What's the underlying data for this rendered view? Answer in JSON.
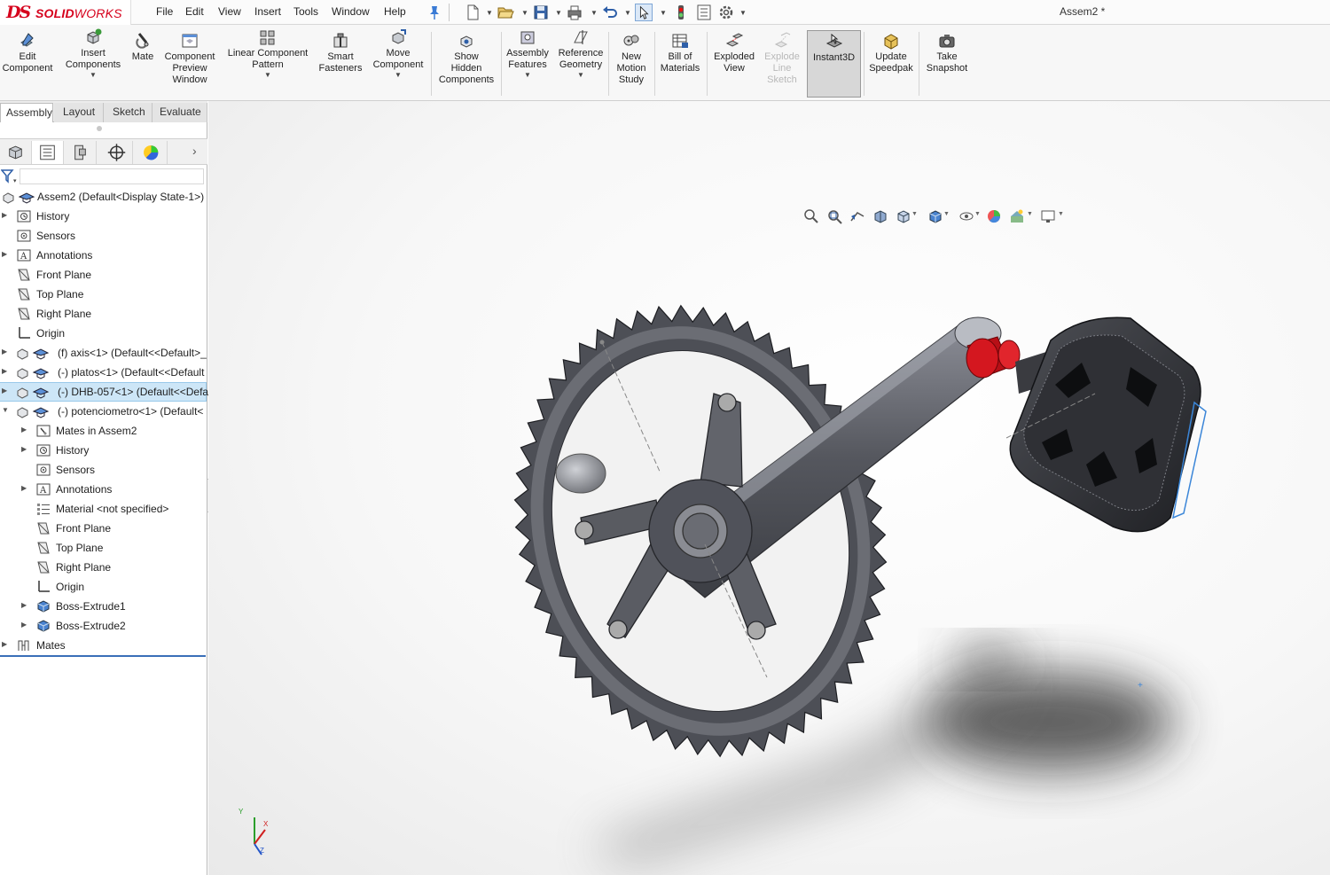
{
  "app": {
    "brand_prefix": "SOLID",
    "brand_suffix": "WORKS",
    "brand_mark": "DS",
    "document_title": "Assem2 *"
  },
  "menu": [
    "File",
    "Edit",
    "View",
    "Insert",
    "Tools",
    "Window",
    "Help"
  ],
  "command_manager": {
    "buttons": [
      {
        "label": "Edit\nComponent",
        "icon": "edit-component-icon"
      },
      {
        "label": "Insert\nComponents",
        "icon": "insert-components-icon",
        "dropdown": true
      },
      {
        "label": "Mate",
        "icon": "mate-icon"
      },
      {
        "label": "Component\nPreview\nWindow",
        "icon": "component-preview-icon"
      },
      {
        "label": "Linear Component\nPattern",
        "icon": "linear-pattern-icon",
        "dropdown": true
      },
      {
        "label": "Smart\nFasteners",
        "icon": "smart-fasteners-icon"
      },
      {
        "label": "Move\nComponent",
        "icon": "move-component-icon",
        "dropdown": true
      },
      {
        "label": "Show\nHidden\nComponents",
        "icon": "show-hidden-icon"
      },
      {
        "label": "Assembly\nFeatures",
        "icon": "assembly-features-icon",
        "dropdown": true
      },
      {
        "label": "Reference\nGeometry",
        "icon": "reference-geometry-icon",
        "dropdown": true
      },
      {
        "label": "New\nMotion\nStudy",
        "icon": "motion-study-icon"
      },
      {
        "label": "Bill of\nMaterials",
        "icon": "bom-icon"
      },
      {
        "label": "Exploded\nView",
        "icon": "exploded-view-icon"
      },
      {
        "label": "Explode\nLine\nSketch",
        "icon": "explode-line-icon",
        "disabled": true
      },
      {
        "label": "Instant3D",
        "icon": "instant3d-icon",
        "active": true
      },
      {
        "label": "Update\nSpeedpak",
        "icon": "speedpak-icon"
      },
      {
        "label": "Take\nSnapshot",
        "icon": "snapshot-icon"
      }
    ]
  },
  "tabs": [
    "Assembly",
    "Layout",
    "Sketch",
    "Evaluate"
  ],
  "active_tab": "Assembly",
  "tree": {
    "root": "Assem2  (Default<Display State-1>)",
    "items": [
      {
        "label": "History",
        "icon": "history-icon",
        "level": 0,
        "expandable": true
      },
      {
        "label": "Sensors",
        "icon": "sensors-icon",
        "level": 0,
        "expandable": false
      },
      {
        "label": "Annotations",
        "icon": "annotations-icon",
        "level": 0,
        "expandable": true
      },
      {
        "label": "Front Plane",
        "icon": "plane-icon",
        "level": 0,
        "expandable": false
      },
      {
        "label": "Top Plane",
        "icon": "plane-icon",
        "level": 0,
        "expandable": false
      },
      {
        "label": "Right Plane",
        "icon": "plane-icon",
        "level": 0,
        "expandable": false
      },
      {
        "label": "Origin",
        "icon": "origin-icon",
        "level": 0,
        "expandable": false
      },
      {
        "label": "(f) axis<1> (Default<<Default>_",
        "icon": "part-icon",
        "level": 0,
        "expandable": true
      },
      {
        "label": "(-) platos<1> (Default<<Default",
        "icon": "part-icon",
        "level": 0,
        "expandable": true
      },
      {
        "label": "(-) DHB-057<1> (Default<<Defa",
        "icon": "part-icon",
        "level": 0,
        "expandable": true,
        "selected": true
      },
      {
        "label": "(-) potenciometro<1> (Default<",
        "icon": "part-icon",
        "level": 0,
        "expandable": true,
        "expanded": true
      },
      {
        "label": "Mates in Assem2",
        "icon": "mates-folder-icon",
        "level": 1,
        "expandable": true
      },
      {
        "label": "History",
        "icon": "history-icon",
        "level": 1,
        "expandable": true
      },
      {
        "label": "Sensors",
        "icon": "sensors-icon",
        "level": 1,
        "expandable": false
      },
      {
        "label": "Annotations",
        "icon": "annotations-icon",
        "level": 1,
        "expandable": true
      },
      {
        "label": "Material <not specified>",
        "icon": "material-icon",
        "level": 1,
        "expandable": false
      },
      {
        "label": "Front Plane",
        "icon": "plane-icon",
        "level": 1,
        "expandable": false
      },
      {
        "label": "Top Plane",
        "icon": "plane-icon",
        "level": 1,
        "expandable": false
      },
      {
        "label": "Right Plane",
        "icon": "plane-icon",
        "level": 1,
        "expandable": false
      },
      {
        "label": "Origin",
        "icon": "origin-icon",
        "level": 1,
        "expandable": false
      },
      {
        "label": "Boss-Extrude1",
        "icon": "extrude-icon",
        "level": 1,
        "expandable": true
      },
      {
        "label": "Boss-Extrude2",
        "icon": "extrude-icon",
        "level": 1,
        "expandable": true
      },
      {
        "label": "Mates",
        "icon": "mates-icon",
        "level": 0,
        "expandable": true
      }
    ]
  },
  "triad": {
    "x": "X",
    "y": "Y",
    "z": "Z"
  },
  "colors": {
    "brand_red": "#d6001c",
    "selection_blue": "#cde6f7",
    "part_gray": "#4d4f55",
    "spacer_red": "#c8141a"
  }
}
